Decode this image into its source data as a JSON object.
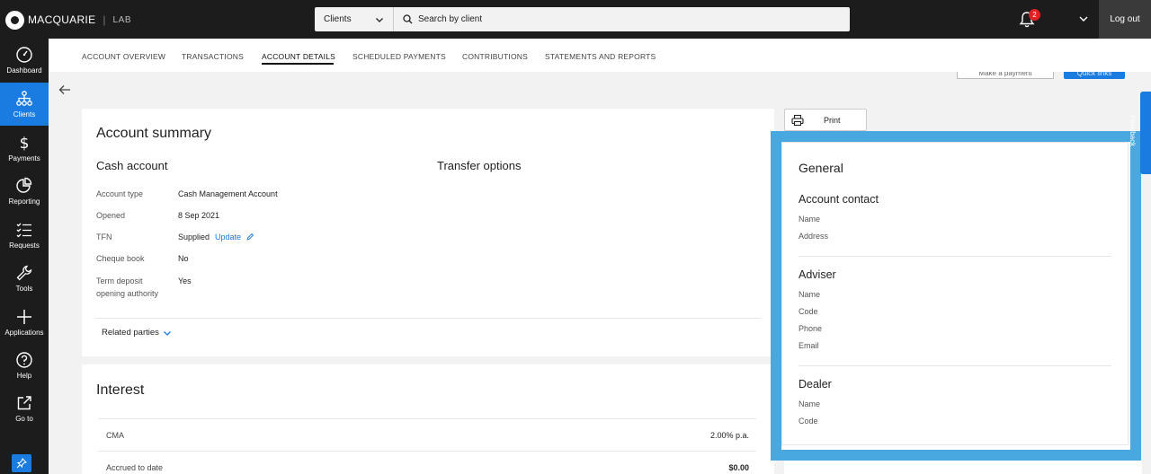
{
  "brand": {
    "name": "MACQUARIE",
    "env": "LAB"
  },
  "search": {
    "client_type": "Clients",
    "placeholder": "Search by client"
  },
  "header": {
    "notification_count": "2",
    "logout_label": "Log out"
  },
  "sidebar": {
    "items": [
      {
        "label": "Dashboard",
        "icon": "dashboard-icon"
      },
      {
        "label": "Clients",
        "icon": "clients-icon",
        "active": true
      },
      {
        "label": "Payments",
        "icon": "dollar-icon"
      },
      {
        "label": "Reporting",
        "icon": "pie-chart-icon"
      },
      {
        "label": "Requests",
        "icon": "checklist-icon"
      },
      {
        "label": "Tools",
        "icon": "wrench-icon"
      },
      {
        "label": "Applications",
        "icon": "plus-icon"
      },
      {
        "label": "Help",
        "icon": "help-icon"
      },
      {
        "label": "Go to",
        "icon": "external-link-icon"
      }
    ]
  },
  "tabs": [
    {
      "label": "ACCOUNT OVERVIEW"
    },
    {
      "label": "TRANSACTIONS"
    },
    {
      "label": "ACCOUNT DETAILS",
      "active": true
    },
    {
      "label": "SCHEDULED PAYMENTS"
    },
    {
      "label": "CONTRIBUTIONS"
    },
    {
      "label": "STATEMENTS AND REPORTS"
    }
  ],
  "actions": {
    "make_payment": "Make a payment",
    "quick_links": "Quick links",
    "print": "Print"
  },
  "summary": {
    "title": "Account summary",
    "cash_account_heading": "Cash account",
    "transfer_heading": "Transfer options",
    "rows": [
      {
        "label": "Account type",
        "value": "Cash Management Account"
      },
      {
        "label": "Opened",
        "value": "8 Sep 2021"
      },
      {
        "label": "TFN",
        "value": "Supplied",
        "link": "Update"
      },
      {
        "label": "Cheque book",
        "value": "No"
      },
      {
        "label": "Term deposit\nopening authority",
        "value": "Yes"
      }
    ],
    "related_parties": "Related parties"
  },
  "interest": {
    "title": "Interest",
    "rows": [
      {
        "label": "CMA",
        "value": "2.00% p.a."
      },
      {
        "label": "Accrued to date",
        "value": "$0.00"
      }
    ]
  },
  "general": {
    "title": "General",
    "account_contact": {
      "heading": "Account contact",
      "fields": [
        "Name",
        "Address"
      ]
    },
    "adviser": {
      "heading": "Adviser",
      "fields": [
        "Name",
        "Code",
        "Phone",
        "Email"
      ]
    },
    "dealer": {
      "heading": "Dealer",
      "fields": [
        "Name",
        "Code"
      ]
    }
  },
  "feedback": {
    "label": "Feedback"
  },
  "colors": {
    "accent": "#1a7ce0",
    "highlight": "#4aa8e0",
    "topbar": "#1c1c1c"
  }
}
